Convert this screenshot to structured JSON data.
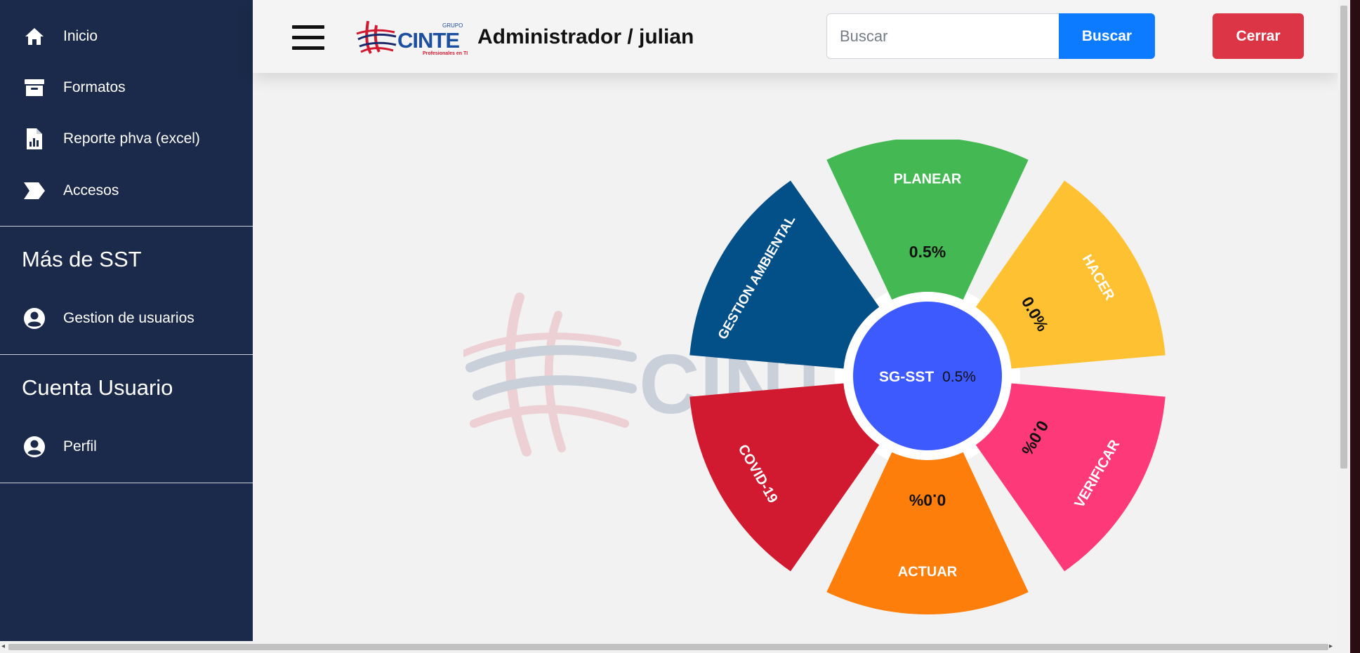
{
  "sidebar": {
    "items": [
      {
        "label": "Inicio",
        "icon": "home-icon"
      },
      {
        "label": "Formatos",
        "icon": "archive-icon"
      },
      {
        "label": "Reporte phva (excel)",
        "icon": "report-file-icon"
      },
      {
        "label": "Accesos",
        "icon": "access-tag-icon"
      }
    ],
    "sections": [
      {
        "title": "Más de SST",
        "items": [
          {
            "label": "Gestion de usuarios",
            "icon": "user-circle-icon"
          }
        ]
      },
      {
        "title": "Cuenta Usuario",
        "items": [
          {
            "label": "Perfil",
            "icon": "user-circle-icon"
          }
        ]
      }
    ]
  },
  "header": {
    "title": "Administrador / julian",
    "logo": {
      "brand": "CINTE",
      "group": "GRUPO",
      "tagline": "Profesionales en TI"
    },
    "search": {
      "placeholder": "Buscar",
      "value": ""
    },
    "search_button": "Buscar",
    "close_button": "Cerrar"
  },
  "wheel": {
    "center": {
      "label": "SG-SST",
      "value": "0.5%",
      "color": "#3d5afe"
    },
    "segments": [
      {
        "label": "PLANEAR",
        "value": "0.5%",
        "color": "#43b853"
      },
      {
        "label": "HACER",
        "value": "0.0%",
        "color": "#fec132"
      },
      {
        "label": "VERIFICAR",
        "value": "0.0%",
        "color": "#fd397a"
      },
      {
        "label": "ACTUAR",
        "value": "0.0%",
        "color": "#fd7e0a"
      },
      {
        "label": "COVID-19",
        "value": "",
        "color": "#d11a30"
      },
      {
        "label": "GESTION AMBIENTAL",
        "value": "",
        "color": "#034f88"
      }
    ]
  },
  "colors": {
    "sidebar_bg": "#1b2a4a",
    "search_button": "#0d7bff",
    "close_button": "#dc3545",
    "background": "#f2f2f2"
  }
}
